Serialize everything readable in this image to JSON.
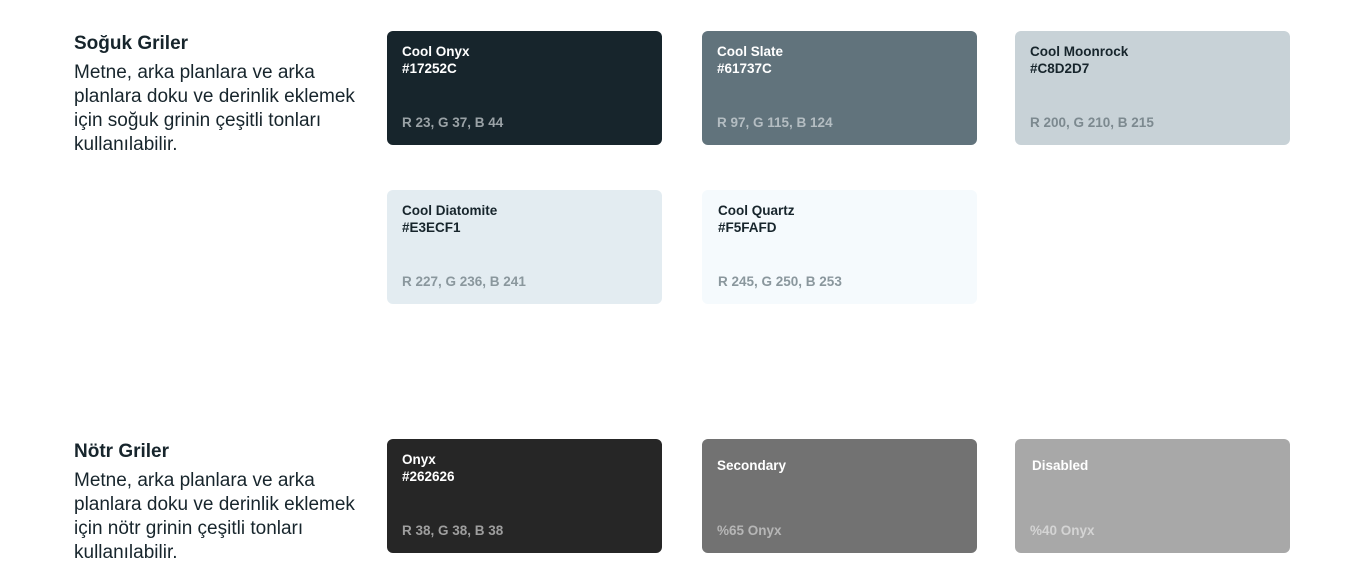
{
  "cool_section": {
    "title": "Soğuk Griler",
    "description": "Metne, arka planlara ve arka planlara doku ve derinlik eklemek için soğuk grinin çeşitli tonları kullanılabilir.",
    "swatches": [
      {
        "name": "Cool Onyx",
        "hex": "#17252C",
        "rgb": "R 23, G 37, B 44",
        "color": "#17252C"
      },
      {
        "name": "Cool Slate",
        "hex": "#61737C",
        "rgb": "R 97, G 115, B 124",
        "color": "#61737C"
      },
      {
        "name": "Cool Moonrock",
        "hex": "#C8D2D7",
        "rgb": "R 200, G 210, B 215",
        "color": "#C8D2D7"
      },
      {
        "name": "Cool Diatomite",
        "hex": "#E3ECF1",
        "rgb": "R 227, G 236, B 241",
        "color": "#E3ECF1"
      },
      {
        "name": "Cool Quartz",
        "hex": "#F5FAFD",
        "rgb": "R 245, G 250, B 253",
        "color": "#F5FAFD"
      }
    ]
  },
  "neutral_section": {
    "title": "Nötr Griler",
    "description": "Metne, arka planlara ve arka planlara doku ve derinlik eklemek için nötr grinin çeşitli tonları kullanılabilir.",
    "swatches": [
      {
        "name": "Onyx",
        "hex": "#262626",
        "rgb": "R 38, G 38, B 38",
        "color": "#262626"
      },
      {
        "name": "Secondary",
        "rgb": "%65 Onyx",
        "color": "#727272"
      },
      {
        "name": "Disabled",
        "rgb": "%40 Onyx",
        "color": "#A8A8A8"
      }
    ]
  },
  "colors": {
    "dark_text": "#17252C",
    "light_text": "#FFFFFF",
    "muted_on_dark": "#9AA2A6",
    "muted_on_light": "#8A979D"
  }
}
